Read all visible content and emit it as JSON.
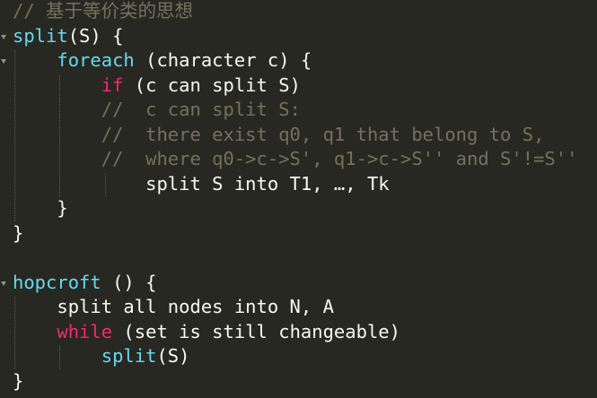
{
  "editor": {
    "theme_colors": {
      "background": "#272822",
      "text": "#f8f8f2",
      "function": "#66d9ef",
      "keyword": "#f92672",
      "comment": "#75715e"
    },
    "lines": [
      {
        "parts": [
          {
            "t": "// 基于等价类的思想",
            "c": "cm"
          }
        ]
      },
      {
        "parts": [
          {
            "t": "split",
            "c": "fn"
          },
          {
            "t": "(S) {",
            "c": "tx"
          }
        ]
      },
      {
        "parts": [
          {
            "t": "    ",
            "c": "tx"
          },
          {
            "t": "foreach",
            "c": "fn"
          },
          {
            "t": " (character c) {",
            "c": "tx"
          }
        ]
      },
      {
        "parts": [
          {
            "t": "        ",
            "c": "tx"
          },
          {
            "t": "if",
            "c": "kw"
          },
          {
            "t": " (c can split S)",
            "c": "tx"
          }
        ]
      },
      {
        "parts": [
          {
            "t": "        //  c can split S:",
            "c": "cm"
          }
        ]
      },
      {
        "parts": [
          {
            "t": "        //  there exist q0, q1 that belong to S,",
            "c": "cm"
          }
        ]
      },
      {
        "parts": [
          {
            "t": "        //  where q0->c->S', q1->c->S'' and S'!=S''",
            "c": "cm"
          }
        ]
      },
      {
        "parts": [
          {
            "t": "            split S into T1, …, Tk",
            "c": "tx"
          }
        ]
      },
      {
        "parts": [
          {
            "t": "    }",
            "c": "tx"
          }
        ]
      },
      {
        "parts": [
          {
            "t": "}",
            "c": "tx"
          }
        ]
      },
      {
        "parts": [
          {
            "t": "",
            "c": "tx"
          }
        ]
      },
      {
        "parts": [
          {
            "t": "hopcroft",
            "c": "fn"
          },
          {
            "t": " () {",
            "c": "tx"
          }
        ]
      },
      {
        "parts": [
          {
            "t": "    split all nodes into N, A",
            "c": "tx"
          }
        ]
      },
      {
        "parts": [
          {
            "t": "    ",
            "c": "tx"
          },
          {
            "t": "while",
            "c": "kw"
          },
          {
            "t": " (set is still changeable)",
            "c": "tx"
          }
        ]
      },
      {
        "parts": [
          {
            "t": "        ",
            "c": "tx"
          },
          {
            "t": "split",
            "c": "fn"
          },
          {
            "t": "(S)",
            "c": "tx"
          }
        ]
      },
      {
        "parts": [
          {
            "t": "}",
            "c": "tx"
          }
        ]
      }
    ]
  },
  "icons": {
    "fold_markers": [
      "fold-arrow-icon"
    ]
  }
}
